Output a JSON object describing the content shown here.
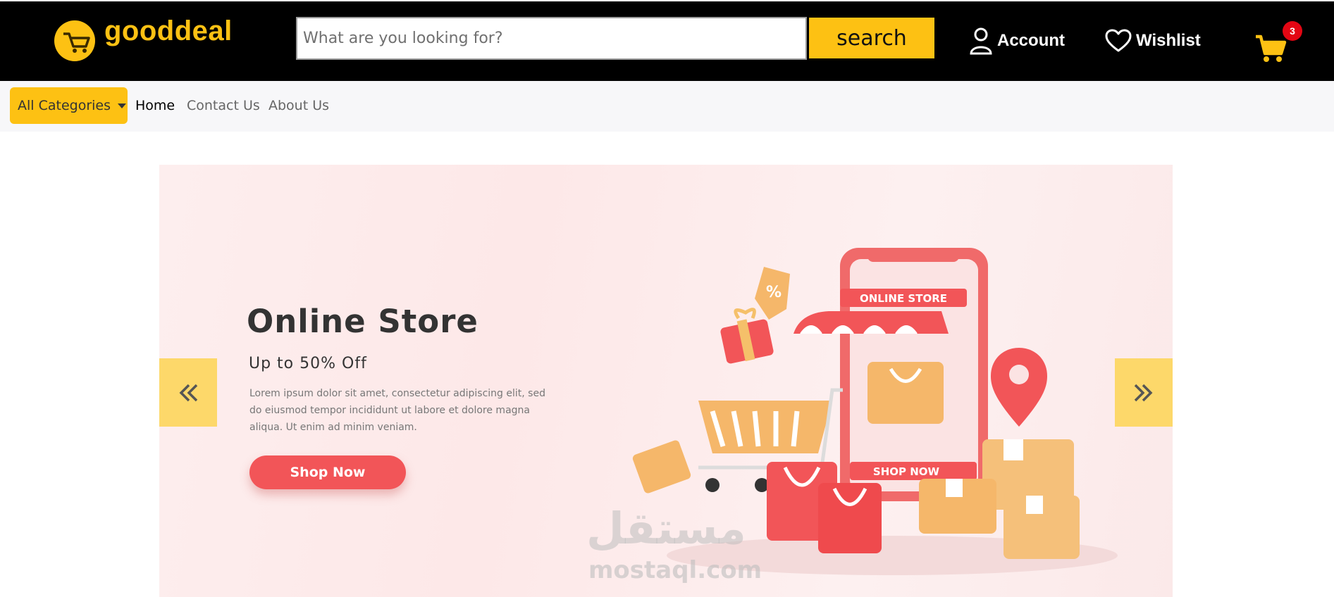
{
  "header": {
    "brand": "gooddeal",
    "search_placeholder": "What are you looking for?",
    "search_label": "search",
    "account_label": "Account",
    "wishlist_label": "Wishlist",
    "cart_count": "3",
    "icons": [
      "cart-logo-icon",
      "user-icon",
      "heart-icon",
      "cart-icon"
    ]
  },
  "subnav": {
    "categories_label": "All Categories",
    "links": [
      "Home",
      "Contact Us",
      "About Us"
    ]
  },
  "hero": {
    "title": "Online Store",
    "subtitle": "Up to 50% Off",
    "text": "Lorem ipsum dolor sit amet, consectetur adipiscing elit, sed do eiusmod tempor incididunt ut labore et dolore magna aliqua. Ut enim ad minim veniam.",
    "button_label": "Shop Now",
    "illustration_text": [
      "ONLINE STORE",
      "SHOP NOW",
      "%"
    ],
    "prev_label": "«",
    "next_label": "»"
  },
  "watermark": {
    "arabic": "مستقل",
    "latin": "mostaql.com"
  },
  "colors": {
    "accent": "#fdc113",
    "topbar": "#000000",
    "hero_button": "#f25558",
    "badge": "#e30613",
    "carousel_button": "#fdd86a"
  }
}
